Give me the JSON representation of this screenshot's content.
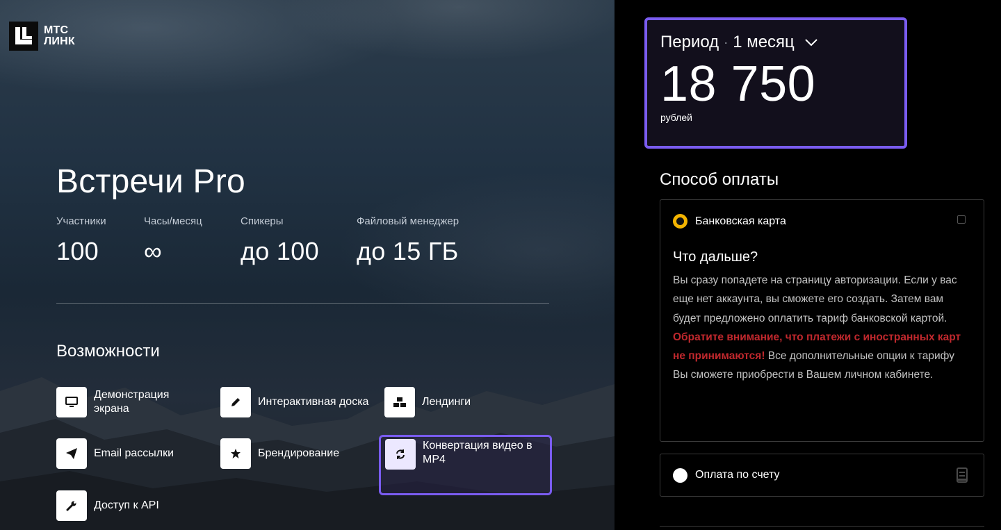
{
  "brand": {
    "name_line1": "МТС",
    "name_line2": "ЛИНК",
    "logo_icon": "mts-link-logo-icon"
  },
  "plan": {
    "title": "Встречи Pro",
    "stats": [
      {
        "label": "Участники",
        "value": "100"
      },
      {
        "label": "Часы/месяц",
        "value": "∞"
      },
      {
        "label": "Спикеры",
        "value": "до 100"
      },
      {
        "label": "Файловый менеджер",
        "value": "до 15 ГБ"
      }
    ]
  },
  "features": {
    "title": "Возможности",
    "items": [
      {
        "label": "Демонстрация экрана",
        "icon": "monitor-icon"
      },
      {
        "label": "Интерактивная доска",
        "icon": "pencil-icon"
      },
      {
        "label": "Лендинги",
        "icon": "cubes-icon"
      },
      {
        "label": "Email рассылки",
        "icon": "paper-plane-icon"
      },
      {
        "label": "Брендирование",
        "icon": "star-icon"
      },
      {
        "label": "Конвертация видео в MP4",
        "icon": "refresh-icon"
      },
      {
        "label": "Доступ к API",
        "icon": "wrench-icon"
      }
    ]
  },
  "period": {
    "label": "Период",
    "separator": "·",
    "value": "1 месяц",
    "price": "18 750",
    "currency": "рублей"
  },
  "payment": {
    "title": "Способ оплаты",
    "options": [
      {
        "label": "Банковская карта",
        "selected": true
      },
      {
        "label": "Оплата по счету",
        "selected": false
      }
    ],
    "next": {
      "title": "Что дальше?",
      "text1": "Вы сразу попадете на страницу авторизации. Если у вас еще нет аккаунта, вы сможете его создать. Затем вам будет предложено оплатить тариф банковской картой.",
      "warning": "Обратите внимание, что платежи с иностранных карт не принимаются!",
      "text2": "Все дополнительные опции к тарифу Вы сможете приобрести в Вашем личном кабинете."
    }
  },
  "colors": {
    "accent": "#7a5cf0",
    "radio_selected": "#f4b400",
    "warning": "#c0282d"
  }
}
